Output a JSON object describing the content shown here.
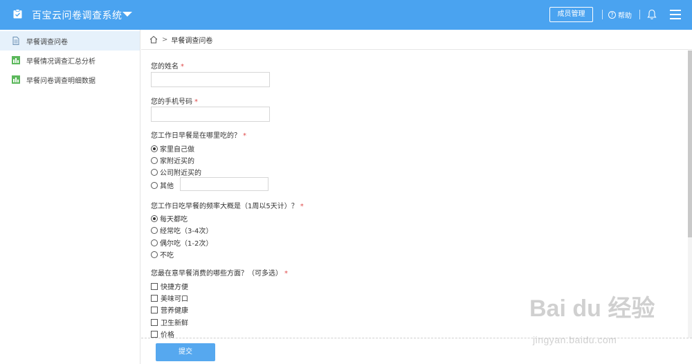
{
  "header": {
    "app_title": "百宝云问卷调查系统",
    "members_label": "成员管理",
    "help_label": "帮助",
    "accent_color": "#4aa3f0"
  },
  "sidebar": {
    "items": [
      {
        "label": "早餐调查问卷",
        "icon": "document-icon",
        "active": true
      },
      {
        "label": "早餐情况调查汇总分析",
        "icon": "bar-chart-icon",
        "active": false
      },
      {
        "label": "早餐问卷调查明细数据",
        "icon": "bar-chart-icon",
        "active": false
      }
    ]
  },
  "breadcrumb": {
    "separator": ">",
    "current": "早餐调查问卷"
  },
  "form": {
    "q1": {
      "label": "您的姓名",
      "required": "*"
    },
    "q2": {
      "label": "您的手机号码",
      "required": "*"
    },
    "q3": {
      "label": "您工作日早餐是在哪里吃的？",
      "required": "*",
      "options": [
        "家里自己做",
        "家附近买的",
        "公司附近买的",
        "其他"
      ],
      "selected": "家里自己做"
    },
    "q4": {
      "label": "您工作日吃早餐的频率大概是（1周以5天计）？",
      "required": "*",
      "options": [
        "每天都吃",
        "经常吃（3-4次）",
        "偶尔吃（1-2次）",
        "不吃"
      ],
      "selected": "每天都吃"
    },
    "q5": {
      "label": "您最在意早餐消费的哪些方面？（可多选）",
      "required": "*",
      "options": [
        "快捷方便",
        "美味可口",
        "营养健康",
        "卫生新鲜",
        "价格"
      ]
    },
    "submit_label": "提交"
  },
  "watermark": {
    "brand": "Bai du 经验",
    "url": "jingyan.baidu.com"
  }
}
